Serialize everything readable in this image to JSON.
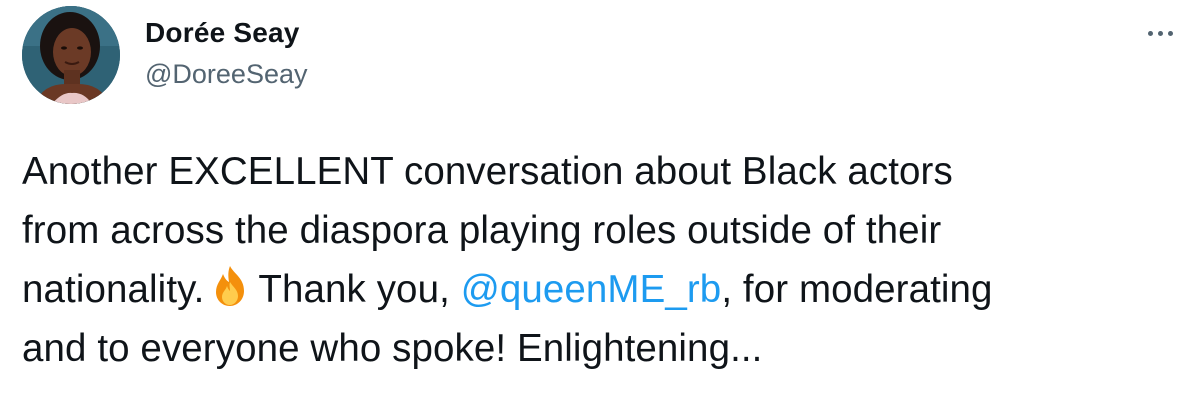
{
  "author": {
    "display_name": "Dorée Seay",
    "handle": "@DoreeSeay",
    "avatar_icon": "profile-photo"
  },
  "menu": {
    "icon": "more-horizontal-icon"
  },
  "tweet": {
    "line1": "Another EXCELLENT conversation about Black actors",
    "line2": "from across the diaspora playing roles outside of their",
    "line3_before_emoji": "nationality.",
    "emoji": "fire-emoji-icon",
    "line3_before_mention": "Thank you,",
    "mention": "@queenME_rb",
    "line3_after_mention": ", for moderating",
    "line4": "and to everyone who spoke! Enlightening..."
  },
  "colors": {
    "text": "#0f1419",
    "secondary": "#536471",
    "link": "#1d9bf0",
    "background": "#ffffff"
  }
}
